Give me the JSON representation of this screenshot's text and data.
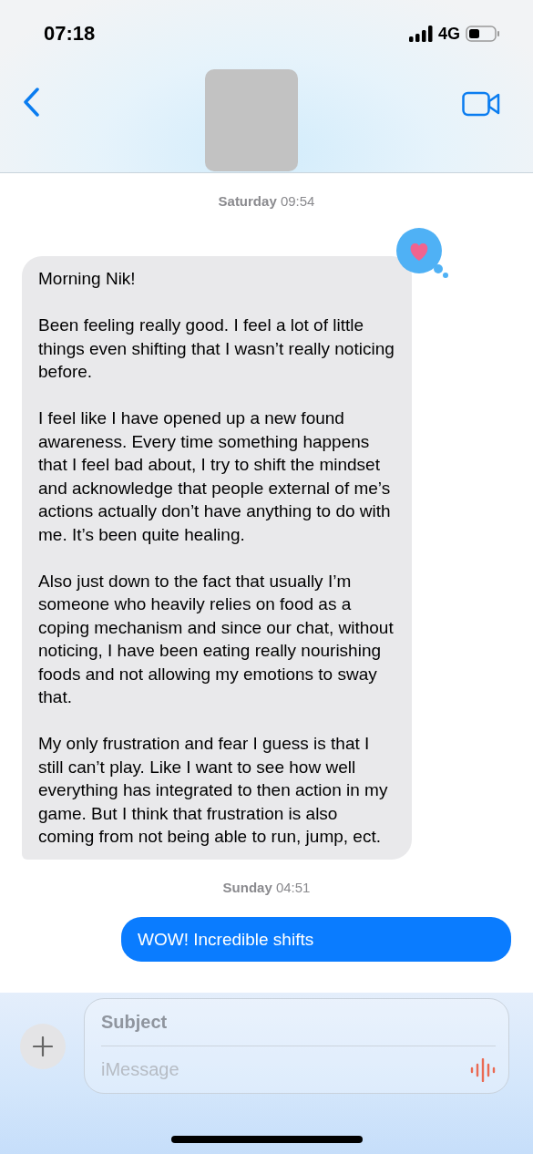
{
  "status_bar": {
    "time": "07:18",
    "network": "4G"
  },
  "messages": [
    {
      "kind": "timestamp",
      "text": "**Saturday** 09:54"
    },
    {
      "kind": "incoming",
      "hearted": true,
      "paragraphs": [
        "Morning Nik!",
        "Been feeling really good. I feel a lot of little things even shifting that I wasn’t really noticing before.",
        "I feel like I have opened up a new found awareness. Every time something happens that I feel bad about, I try to shift the mindset and acknowledge that people external of me’s actions actually don’t have anything to do with me. It’s been quite healing.",
        "Also just down to the fact that usually I’m someone who heavily relies on food as a coping mechanism and since our chat, without noticing, I have been eating really nourishing foods and not allowing my emotions to sway that.",
        "My only frustration and fear I guess is that I still can’t play. Like I want to see how well everything has integrated to then action in my game. But I think that frustration is also coming from not being able to run, jump, ect."
      ]
    },
    {
      "kind": "timestamp",
      "text": "**Sunday** 04:51"
    },
    {
      "kind": "outgoing",
      "paragraphs": [
        "WOW! Incredible shifts"
      ]
    }
  ],
  "compose": {
    "subject_placeholder": "Subject",
    "message_placeholder": "iMessage"
  }
}
